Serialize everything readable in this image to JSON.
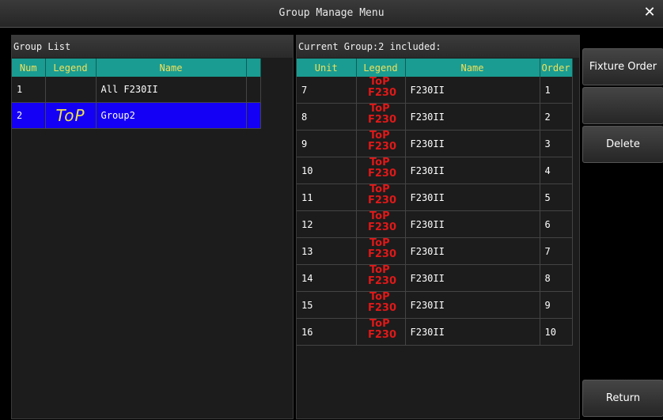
{
  "window": {
    "title": "Group Manage Menu",
    "close_glyph": "✕"
  },
  "group_list": {
    "header": "Group List",
    "columns": {
      "num": "Num",
      "legend": "Legend",
      "name": "Name"
    },
    "rows": [
      {
        "num": "1",
        "legend": "",
        "name": "All F230II",
        "selected": false
      },
      {
        "num": "2",
        "legend": "ToP",
        "name": "Group2",
        "selected": true
      }
    ]
  },
  "current_group": {
    "header": "Current Group:2 included:",
    "columns": {
      "unit": "Unit",
      "legend": "Legend",
      "name": "Name",
      "order": "Order"
    },
    "legend_logo": {
      "line1": "ToP",
      "line2": "F230",
      "icon": "top-f230-logo"
    },
    "rows": [
      {
        "unit": "7",
        "name": "F230II",
        "order": "1"
      },
      {
        "unit": "8",
        "name": "F230II",
        "order": "2"
      },
      {
        "unit": "9",
        "name": "F230II",
        "order": "3"
      },
      {
        "unit": "10",
        "name": "F230II",
        "order": "4"
      },
      {
        "unit": "11",
        "name": "F230II",
        "order": "5"
      },
      {
        "unit": "12",
        "name": "F230II",
        "order": "6"
      },
      {
        "unit": "13",
        "name": "F230II",
        "order": "7"
      },
      {
        "unit": "14",
        "name": "F230II",
        "order": "8"
      },
      {
        "unit": "15",
        "name": "F230II",
        "order": "9"
      },
      {
        "unit": "16",
        "name": "F230II",
        "order": "10"
      }
    ]
  },
  "side_buttons": {
    "fixture_order": "Fixture Order",
    "blank": "",
    "delete": "Delete",
    "return": "Return"
  },
  "colors": {
    "header_teal": "#1a9c92",
    "header_text": "#f2e15a",
    "selected_row": "#1400f5",
    "legend_red": "#e11818"
  }
}
